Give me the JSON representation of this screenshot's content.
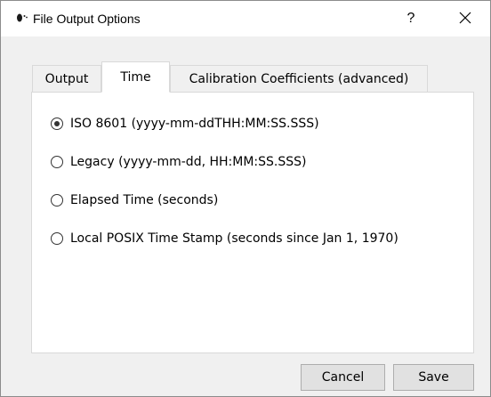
{
  "window": {
    "title": "File Output Options",
    "help_label": "?",
    "icon": "app-icon",
    "close_icon": "close-icon"
  },
  "tabs": [
    {
      "label": "Output",
      "active": false
    },
    {
      "label": "Time",
      "active": true
    },
    {
      "label": "Calibration Coefficients (advanced)",
      "active": false
    }
  ],
  "time_options": [
    {
      "label": "ISO 8601 (yyyy-mm-ddTHH:MM:SS.SSS)",
      "checked": true
    },
    {
      "label": "Legacy (yyyy-mm-dd, HH:MM:SS.SSS)",
      "checked": false
    },
    {
      "label": "Elapsed Time (seconds)",
      "checked": false
    },
    {
      "label": "Local POSIX Time Stamp (seconds since Jan 1, 1970)",
      "checked": false
    }
  ],
  "buttons": {
    "cancel_label": "Cancel",
    "save_label": "Save"
  }
}
